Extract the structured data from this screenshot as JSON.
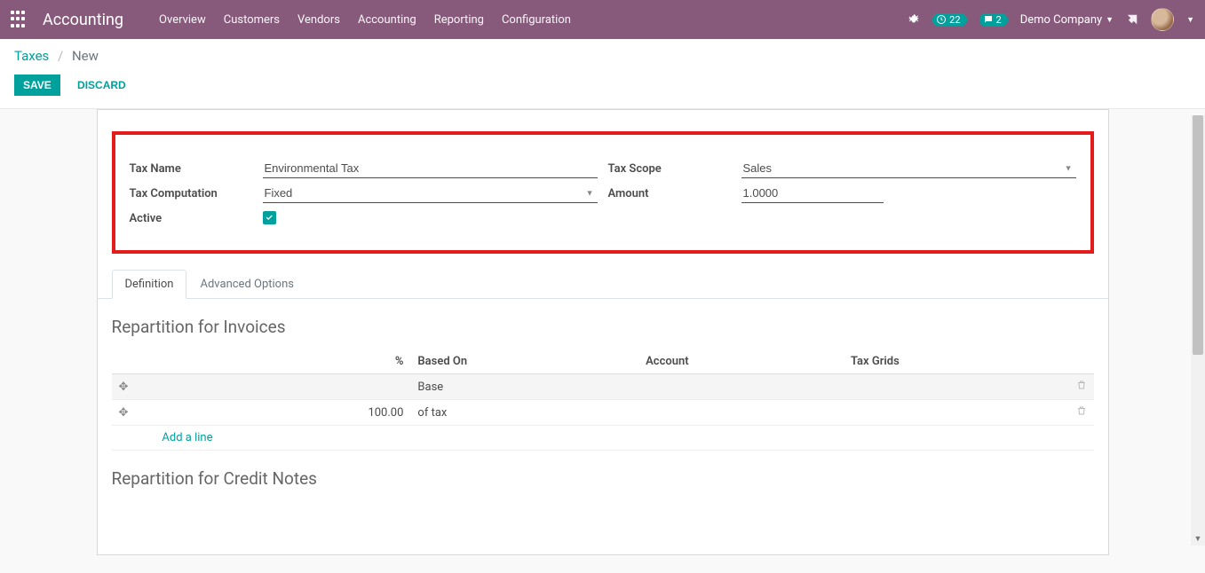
{
  "nav": {
    "brand": "Accounting",
    "menu": [
      "Overview",
      "Customers",
      "Vendors",
      "Accounting",
      "Reporting",
      "Configuration"
    ],
    "clock_badge": "22",
    "msg_badge": "2",
    "company": "Demo Company"
  },
  "breadcrumb": {
    "root": "Taxes",
    "current": "New"
  },
  "buttons": {
    "save": "SAVE",
    "discard": "DISCARD"
  },
  "form": {
    "tax_name_label": "Tax Name",
    "tax_name_value": "Environmental Tax",
    "tax_computation_label": "Tax Computation",
    "tax_computation_value": "Fixed",
    "active_label": "Active",
    "active_checked": true,
    "tax_scope_label": "Tax Scope",
    "tax_scope_value": "Sales",
    "amount_label": "Amount",
    "amount_value": "1.0000"
  },
  "tabs": {
    "definition": "Definition",
    "advanced": "Advanced Options"
  },
  "section_invoices": {
    "title": "Repartition for Invoices",
    "cols": {
      "pct": "%",
      "based_on": "Based On",
      "account": "Account",
      "tax_grids": "Tax Grids"
    },
    "rows": [
      {
        "pct": "",
        "based_on": "Base"
      },
      {
        "pct": "100.00",
        "based_on": "of tax"
      }
    ],
    "add_line": "Add a line"
  },
  "section_credit": {
    "title": "Repartition for Credit Notes"
  }
}
